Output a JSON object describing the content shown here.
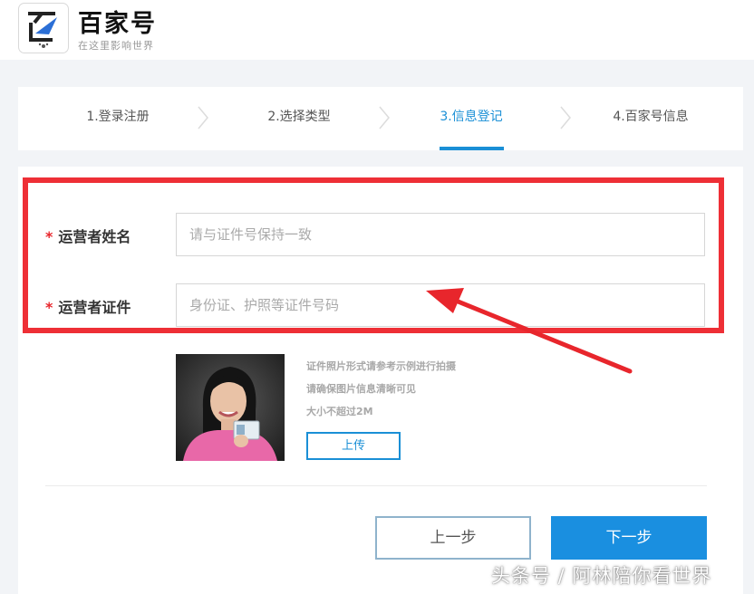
{
  "header": {
    "brand_name": "百家号",
    "slogan": "在这里影响世界"
  },
  "steps": [
    {
      "label": "1.登录注册",
      "active": false
    },
    {
      "label": "2.选择类型",
      "active": false
    },
    {
      "label": "3.信息登记",
      "active": true
    },
    {
      "label": "4.百家号信息",
      "active": false
    }
  ],
  "form": {
    "name_field": {
      "required_mark": "*",
      "label": "运营者姓名",
      "value": "",
      "placeholder": "请与证件号保持一致"
    },
    "id_field": {
      "required_mark": "*",
      "label": "运营者证件",
      "value": "",
      "placeholder": "身份证、护照等证件号码"
    },
    "upload": {
      "hints": [
        "证件照片形式请参考示例进行拍摄",
        "请确保图片信息清晰可见",
        "大小不超过2M"
      ],
      "button_label": "上传"
    }
  },
  "actions": {
    "prev_label": "上一步",
    "next_label": "下一步"
  },
  "watermark": "头条号 / 阿林陪你看世界",
  "colors": {
    "accent": "#1a8fd6",
    "primary_button": "#1a8fe0",
    "highlight": "#ee2f36",
    "required": "#e8262c"
  }
}
